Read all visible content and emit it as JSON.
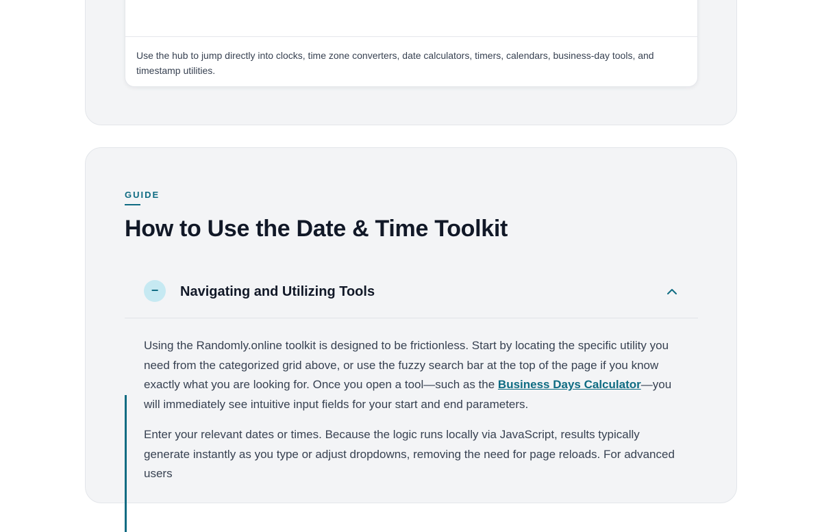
{
  "hub": {
    "caption": "Use the hub to jump directly into clocks, time zone converters, date calculators, timers, calendars, business-day tools, and timestamp utilities."
  },
  "guide": {
    "eyebrow": "GUIDE",
    "title": "How to Use the Date & Time Toolkit",
    "accordion": {
      "badge_symbol": "−",
      "title": "Navigating and Utilizing Tools",
      "chevron_icon": "chevron-up-icon",
      "paragraph1_before": "Using the Randomly.online toolkit is designed to be frictionless. Start by locating the specific utility you need from the categorized grid above, or use the fuzzy search bar at the top of the page if you know exactly what you are looking for. Once you open a tool—such as the ",
      "paragraph1_link": "Business Days Calculator",
      "paragraph1_after": "—you will immediately see intuitive input fields for your start and end parameters.",
      "paragraph2": "Enter your relevant dates or times. Because the logic runs locally via JavaScript, results typically generate instantly as you type or adjust dropdowns, removing the need for page reloads. For advanced users"
    }
  },
  "colors": {
    "accent": "#0e6b82",
    "panel_bg": "#f3f4f6",
    "badge_bg": "#c6e9f2"
  }
}
